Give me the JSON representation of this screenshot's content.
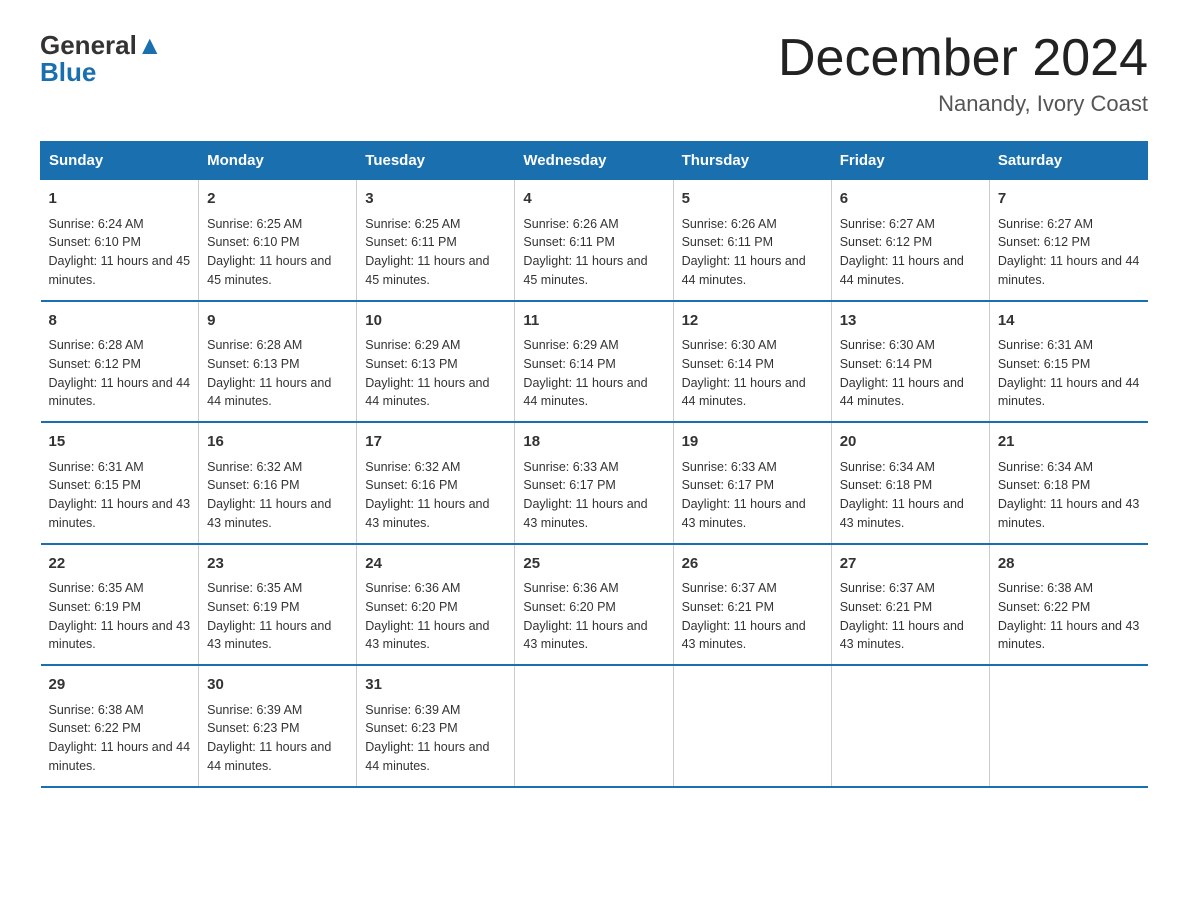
{
  "header": {
    "logo_line1": "General",
    "logo_line2": "Blue",
    "month_title": "December 2024",
    "location": "Nanandy, Ivory Coast"
  },
  "days_of_week": [
    "Sunday",
    "Monday",
    "Tuesday",
    "Wednesday",
    "Thursday",
    "Friday",
    "Saturday"
  ],
  "weeks": [
    [
      {
        "day": "1",
        "sunrise": "Sunrise: 6:24 AM",
        "sunset": "Sunset: 6:10 PM",
        "daylight": "Daylight: 11 hours and 45 minutes."
      },
      {
        "day": "2",
        "sunrise": "Sunrise: 6:25 AM",
        "sunset": "Sunset: 6:10 PM",
        "daylight": "Daylight: 11 hours and 45 minutes."
      },
      {
        "day": "3",
        "sunrise": "Sunrise: 6:25 AM",
        "sunset": "Sunset: 6:11 PM",
        "daylight": "Daylight: 11 hours and 45 minutes."
      },
      {
        "day": "4",
        "sunrise": "Sunrise: 6:26 AM",
        "sunset": "Sunset: 6:11 PM",
        "daylight": "Daylight: 11 hours and 45 minutes."
      },
      {
        "day": "5",
        "sunrise": "Sunrise: 6:26 AM",
        "sunset": "Sunset: 6:11 PM",
        "daylight": "Daylight: 11 hours and 44 minutes."
      },
      {
        "day": "6",
        "sunrise": "Sunrise: 6:27 AM",
        "sunset": "Sunset: 6:12 PM",
        "daylight": "Daylight: 11 hours and 44 minutes."
      },
      {
        "day": "7",
        "sunrise": "Sunrise: 6:27 AM",
        "sunset": "Sunset: 6:12 PM",
        "daylight": "Daylight: 11 hours and 44 minutes."
      }
    ],
    [
      {
        "day": "8",
        "sunrise": "Sunrise: 6:28 AM",
        "sunset": "Sunset: 6:12 PM",
        "daylight": "Daylight: 11 hours and 44 minutes."
      },
      {
        "day": "9",
        "sunrise": "Sunrise: 6:28 AM",
        "sunset": "Sunset: 6:13 PM",
        "daylight": "Daylight: 11 hours and 44 minutes."
      },
      {
        "day": "10",
        "sunrise": "Sunrise: 6:29 AM",
        "sunset": "Sunset: 6:13 PM",
        "daylight": "Daylight: 11 hours and 44 minutes."
      },
      {
        "day": "11",
        "sunrise": "Sunrise: 6:29 AM",
        "sunset": "Sunset: 6:14 PM",
        "daylight": "Daylight: 11 hours and 44 minutes."
      },
      {
        "day": "12",
        "sunrise": "Sunrise: 6:30 AM",
        "sunset": "Sunset: 6:14 PM",
        "daylight": "Daylight: 11 hours and 44 minutes."
      },
      {
        "day": "13",
        "sunrise": "Sunrise: 6:30 AM",
        "sunset": "Sunset: 6:14 PM",
        "daylight": "Daylight: 11 hours and 44 minutes."
      },
      {
        "day": "14",
        "sunrise": "Sunrise: 6:31 AM",
        "sunset": "Sunset: 6:15 PM",
        "daylight": "Daylight: 11 hours and 44 minutes."
      }
    ],
    [
      {
        "day": "15",
        "sunrise": "Sunrise: 6:31 AM",
        "sunset": "Sunset: 6:15 PM",
        "daylight": "Daylight: 11 hours and 43 minutes."
      },
      {
        "day": "16",
        "sunrise": "Sunrise: 6:32 AM",
        "sunset": "Sunset: 6:16 PM",
        "daylight": "Daylight: 11 hours and 43 minutes."
      },
      {
        "day": "17",
        "sunrise": "Sunrise: 6:32 AM",
        "sunset": "Sunset: 6:16 PM",
        "daylight": "Daylight: 11 hours and 43 minutes."
      },
      {
        "day": "18",
        "sunrise": "Sunrise: 6:33 AM",
        "sunset": "Sunset: 6:17 PM",
        "daylight": "Daylight: 11 hours and 43 minutes."
      },
      {
        "day": "19",
        "sunrise": "Sunrise: 6:33 AM",
        "sunset": "Sunset: 6:17 PM",
        "daylight": "Daylight: 11 hours and 43 minutes."
      },
      {
        "day": "20",
        "sunrise": "Sunrise: 6:34 AM",
        "sunset": "Sunset: 6:18 PM",
        "daylight": "Daylight: 11 hours and 43 minutes."
      },
      {
        "day": "21",
        "sunrise": "Sunrise: 6:34 AM",
        "sunset": "Sunset: 6:18 PM",
        "daylight": "Daylight: 11 hours and 43 minutes."
      }
    ],
    [
      {
        "day": "22",
        "sunrise": "Sunrise: 6:35 AM",
        "sunset": "Sunset: 6:19 PM",
        "daylight": "Daylight: 11 hours and 43 minutes."
      },
      {
        "day": "23",
        "sunrise": "Sunrise: 6:35 AM",
        "sunset": "Sunset: 6:19 PM",
        "daylight": "Daylight: 11 hours and 43 minutes."
      },
      {
        "day": "24",
        "sunrise": "Sunrise: 6:36 AM",
        "sunset": "Sunset: 6:20 PM",
        "daylight": "Daylight: 11 hours and 43 minutes."
      },
      {
        "day": "25",
        "sunrise": "Sunrise: 6:36 AM",
        "sunset": "Sunset: 6:20 PM",
        "daylight": "Daylight: 11 hours and 43 minutes."
      },
      {
        "day": "26",
        "sunrise": "Sunrise: 6:37 AM",
        "sunset": "Sunset: 6:21 PM",
        "daylight": "Daylight: 11 hours and 43 minutes."
      },
      {
        "day": "27",
        "sunrise": "Sunrise: 6:37 AM",
        "sunset": "Sunset: 6:21 PM",
        "daylight": "Daylight: 11 hours and 43 minutes."
      },
      {
        "day": "28",
        "sunrise": "Sunrise: 6:38 AM",
        "sunset": "Sunset: 6:22 PM",
        "daylight": "Daylight: 11 hours and 43 minutes."
      }
    ],
    [
      {
        "day": "29",
        "sunrise": "Sunrise: 6:38 AM",
        "sunset": "Sunset: 6:22 PM",
        "daylight": "Daylight: 11 hours and 44 minutes."
      },
      {
        "day": "30",
        "sunrise": "Sunrise: 6:39 AM",
        "sunset": "Sunset: 6:23 PM",
        "daylight": "Daylight: 11 hours and 44 minutes."
      },
      {
        "day": "31",
        "sunrise": "Sunrise: 6:39 AM",
        "sunset": "Sunset: 6:23 PM",
        "daylight": "Daylight: 11 hours and 44 minutes."
      },
      null,
      null,
      null,
      null
    ]
  ]
}
